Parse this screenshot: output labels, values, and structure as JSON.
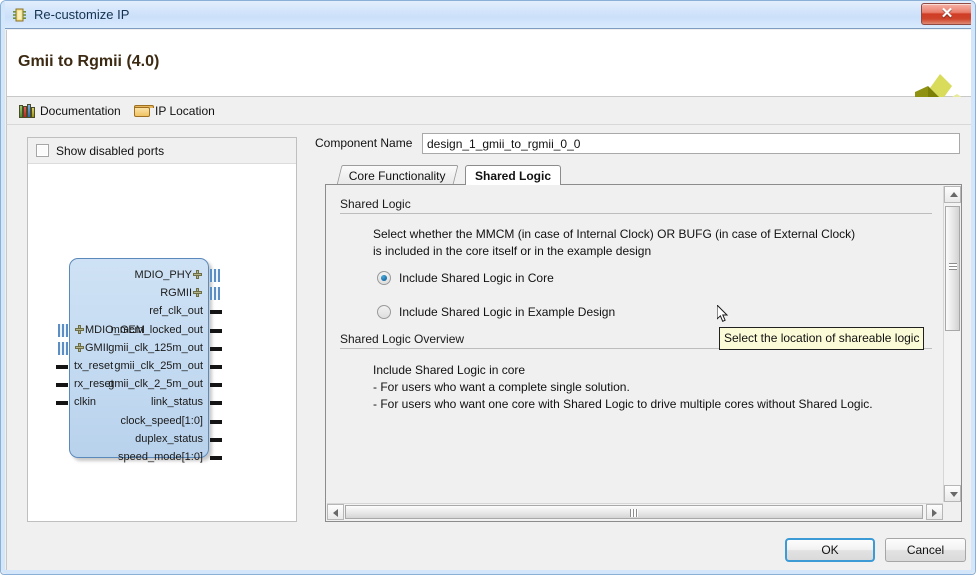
{
  "window": {
    "title": "Re-customize IP",
    "title_icon": "ip-block-icon",
    "close_label": "✕"
  },
  "header": {
    "ip_title": "Gmii to Rgmii (4.0)",
    "logo": "xilinx-logo"
  },
  "toolbar": {
    "documentation_label": "Documentation",
    "documentation_icon": "books-icon",
    "ip_location_label": "IP Location",
    "ip_location_icon": "folder-icon"
  },
  "left_panel": {
    "show_disabled_ports_label": "Show disabled ports",
    "show_disabled_ports_checked": false,
    "block": {
      "right_ports": [
        {
          "label": "MDIO_PHY",
          "type": "bus"
        },
        {
          "label": "RGMII",
          "type": "bus"
        },
        {
          "label": "ref_clk_out",
          "type": "single"
        },
        {
          "label": "mmcm_locked_out",
          "type": "single"
        },
        {
          "label": "gmii_clk_125m_out",
          "type": "single"
        },
        {
          "label": "gmii_clk_25m_out",
          "type": "single"
        },
        {
          "label": "gmii_clk_2_5m_out",
          "type": "single"
        },
        {
          "label": "link_status",
          "type": "single"
        },
        {
          "label": "clock_speed[1:0]",
          "type": "single"
        },
        {
          "label": "duplex_status",
          "type": "single"
        },
        {
          "label": "speed_mode[1:0]",
          "type": "single"
        }
      ],
      "left_ports": [
        {
          "label": "MDIO_GEM",
          "type": "bus"
        },
        {
          "label": "GMII",
          "type": "bus"
        },
        {
          "label": "tx_reset",
          "type": "single"
        },
        {
          "label": "rx_reset",
          "type": "single"
        },
        {
          "label": "clkin",
          "type": "single"
        }
      ]
    }
  },
  "main": {
    "component_name_label": "Component Name",
    "component_name_value": "design_1_gmii_to_rgmii_0_0",
    "component_name_placeholder": "Component Name",
    "tabs": [
      {
        "label": "Core Functionality",
        "active": false
      },
      {
        "label": "Shared Logic",
        "active": true
      }
    ],
    "shared_logic": {
      "section_title": "Shared Logic",
      "description_line1": "Select whether the MMCM (in case of Internal Clock) OR BUFG (in case of External Clock)",
      "description_line2": "is included in the core itself or in the example design",
      "options": [
        {
          "label": "Include Shared Logic in Core",
          "selected": true
        },
        {
          "label": "Include Shared Logic in Example Design",
          "selected": false
        }
      ]
    },
    "overview": {
      "section_title": "Shared Logic Overview",
      "line1": "Include Shared Logic in core",
      "line2": "- For users who want a complete single solution.",
      "line3": "- For users who want one core with Shared Logic to drive multiple cores without Shared Logic."
    }
  },
  "tooltip": {
    "text": "Select the location of shareable logic"
  },
  "footer": {
    "ok_label": "OK",
    "cancel_label": "Cancel"
  },
  "colors": {
    "titlebar": "#cbe0fa",
    "close_button": "#d03c25",
    "accent_focus": "#3c9bd4",
    "radio_selected": "#1e74ad",
    "ip_block_fill": "#c3daf1",
    "ip_block_border": "#5b89bb",
    "tooltip_bg": "#fcfbd8",
    "logo": "#c6cc2e"
  }
}
